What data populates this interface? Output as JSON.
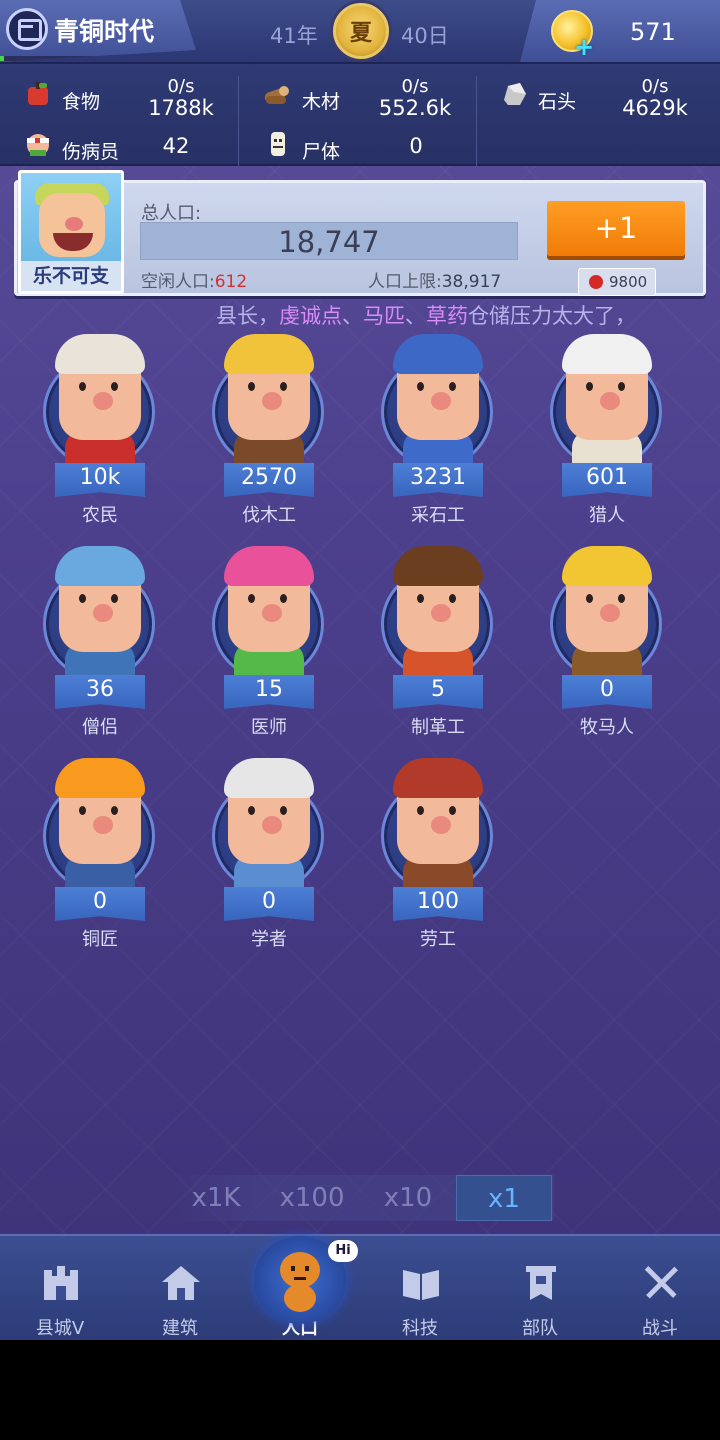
{
  "top_bar": {
    "era": "青铜时代",
    "era_progress": 0.02,
    "year": "41年",
    "season": "夏",
    "day": "40日",
    "coins": "571"
  },
  "resources": [
    {
      "name": "食物",
      "rate": "0/s",
      "amount": "1788k",
      "icon": "apple-icon",
      "color": "#d93a2f"
    },
    {
      "name": "木材",
      "rate": "0/s",
      "amount": "552.6k",
      "icon": "log-icon",
      "color": "#a0703c"
    },
    {
      "name": "石头",
      "rate": "0/s",
      "amount": "4629k",
      "icon": "stone-icon",
      "color": "#c9c9c9"
    }
  ],
  "secondary_resources": [
    {
      "name": "伤病员",
      "value": "42",
      "icon": "wounded-icon"
    },
    {
      "name": "尸体",
      "value": "0",
      "icon": "corpse-icon"
    }
  ],
  "population": {
    "leader_name": "乐不可支",
    "title": "总人口:",
    "total": "18,747",
    "idle_label": "空闲人口:",
    "idle": "612",
    "cap_label": "人口上限:",
    "cap": "38,917",
    "add_button": "+1",
    "cost": "9800"
  },
  "ticker": {
    "prefix": "县长，",
    "highlight1": "虔诚点",
    "sep1": "、",
    "highlight2": "马匹",
    "sep2": "、",
    "highlight3": "草药",
    "suffix": "仓储压力太大了，"
  },
  "workers": [
    {
      "name": "农民",
      "count": "10k",
      "hair": "#e9e3d9",
      "skin": "#f2b99a",
      "body": "#c9302c"
    },
    {
      "name": "伐木工",
      "count": "2570",
      "hair": "#f0c33a",
      "skin": "#f2b99a",
      "body": "#7b4a2a"
    },
    {
      "name": "采石工",
      "count": "3231",
      "hair": "#3d68c6",
      "skin": "#f2b99a",
      "body": "#3e6bc9"
    },
    {
      "name": "猎人",
      "count": "601",
      "hair": "#f0f0f0",
      "skin": "#f2b99a",
      "body": "#e8e0d0"
    },
    {
      "name": "僧侣",
      "count": "36",
      "hair": "#6aa8e0",
      "skin": "#f2b99a",
      "body": "#3f74b8"
    },
    {
      "name": "医师",
      "count": "15",
      "hair": "#e9529a",
      "skin": "#f2b99a",
      "body": "#54b949"
    },
    {
      "name": "制革工",
      "count": "5",
      "hair": "#6b3e1f",
      "skin": "#f2b99a",
      "body": "#d5542c"
    },
    {
      "name": "牧马人",
      "count": "0",
      "hair": "#f2c633",
      "skin": "#f2b99a",
      "body": "#8a5a2a"
    },
    {
      "name": "铜匠",
      "count": "0",
      "hair": "#f79a1e",
      "skin": "#f2b99a",
      "body": "#3b5fa5"
    },
    {
      "name": "学者",
      "count": "0",
      "hair": "#e6e6e6",
      "skin": "#f2b99a",
      "body": "#5a8ed0"
    },
    {
      "name": "劳工",
      "count": "100",
      "hair": "#b23a2a",
      "skin": "#f2b99a",
      "body": "#8a4a2a"
    }
  ],
  "multipliers": [
    "x1K",
    "x100",
    "x10",
    "x1"
  ],
  "active_multiplier": "x1",
  "nav": [
    {
      "label": "县城V",
      "icon": "castle-icon"
    },
    {
      "label": "建筑",
      "icon": "house-icon"
    },
    {
      "label": "人口",
      "icon": "person-icon",
      "badge": "Hi"
    },
    {
      "label": "科技",
      "icon": "book-icon"
    },
    {
      "label": "部队",
      "icon": "banner-icon"
    },
    {
      "label": "战斗",
      "icon": "crossed-swords-icon"
    }
  ],
  "active_nav": "人口"
}
